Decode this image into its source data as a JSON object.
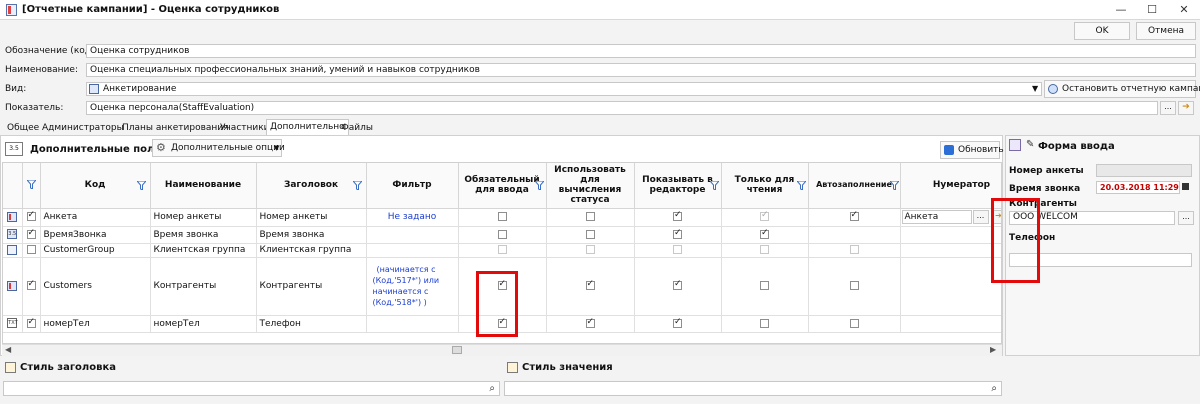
{
  "window": {
    "title": "[Отчетные кампании] - Оценка сотрудников",
    "minimize": "—",
    "maximize": "☐",
    "close": "✕"
  },
  "actions": {
    "ok": "OK",
    "cancel": "Отмена"
  },
  "form": {
    "code_label": "Обозначение (код):",
    "code_value": "Оценка сотрудников",
    "name_label": "Наименование:",
    "name_value": "Оценка специальных профессиональных знаний, умений и навыков сотрудников",
    "view_label": "Вид:",
    "view_value": "Анкетирование",
    "stop_button": "Остановить отчетную кампанию",
    "indicator_label": "Показатель:",
    "indicator_value": "Оценка персонала(StaffEvaluation)",
    "ellipsis": "..."
  },
  "tabs": [
    "Общее",
    "Администраторы",
    "Планы анкетирования",
    "Участники",
    "Дополнительно",
    "Файлы"
  ],
  "panel": {
    "title": "Дополнительные поля",
    "options_button": "Дополнительные опции",
    "refresh_button": "Обновить"
  },
  "grid": {
    "headers": {
      "code": "Код",
      "name": "Наименование",
      "heading": "Заголовок",
      "filter": "Фильтр",
      "required": "Обязательный для ввода",
      "use_status": "Использовать для вычисления статуса",
      "show_editor": "Показывать в редакторе",
      "readonly": "Только для чтения",
      "autofill": "Автозаполнение",
      "numerator": "Нумератор"
    },
    "rows": [
      {
        "icon": "",
        "code": "Анкета",
        "name": "Номер анкеты",
        "heading": "Номер анкеты",
        "filter": "Не задано",
        "numerator": "Анкета"
      },
      {
        "icon": "3.5",
        "code": "ВремяЗвонка",
        "name": "Время звонка",
        "heading": "Время звонка",
        "filter": "",
        "numerator": ""
      },
      {
        "icon": "",
        "code": "CustomerGroup",
        "name": "Клиентская группа",
        "heading": "Клиентская группа",
        "filter": "",
        "numerator": ""
      },
      {
        "icon": "",
        "code": "Customers",
        "name": "Контрагенты",
        "heading": "Контрагенты",
        "filter_lines": [
          "(начинается с",
          "(Код,'517*')    или",
          "начинается с",
          "(Код,'518*') )"
        ],
        "numerator": ""
      },
      {
        "icon": "TXT",
        "code": "номерТел",
        "name": "номерТел",
        "heading": "Телефон",
        "filter": "",
        "numerator": ""
      }
    ]
  },
  "right_panel": {
    "title": "Форма ввода",
    "questionnaire_label": "Номер анкеты",
    "call_time_label": "Время звонка",
    "call_time_value": "20.03.2018 11:29",
    "counterparties_label": "Контрагенты",
    "counterparties_value": "ООО WELCOM",
    "phone_label": "Телефон"
  },
  "bottom": {
    "header_style": "Стиль заголовка",
    "value_style": "Стиль значения"
  },
  "colors": {
    "highlight": "#e20a0a",
    "accent_blue": "#1c3ed1",
    "date_red": "#c40000"
  }
}
